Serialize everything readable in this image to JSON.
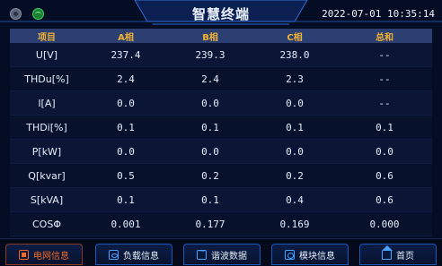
{
  "header": {
    "title": "智慧终端",
    "datetime": "2022-07-01 10:35:14"
  },
  "table": {
    "columns": [
      "项目",
      "A相",
      "B相",
      "C相",
      "总和"
    ],
    "rows": [
      [
        "U[V]",
        "237.4",
        "239.3",
        "238.0",
        "--"
      ],
      [
        "THDu[%]",
        "2.4",
        "2.4",
        "2.3",
        "--"
      ],
      [
        "I[A]",
        "0.0",
        "0.0",
        "0.0",
        "--"
      ],
      [
        "THDi[%]",
        "0.1",
        "0.1",
        "0.1",
        "0.1"
      ],
      [
        "P[kW]",
        "0.0",
        "0.0",
        "0.0",
        "0.0"
      ],
      [
        "Q[kvar]",
        "0.5",
        "0.2",
        "0.2",
        "0.6"
      ],
      [
        "S[kVA]",
        "0.1",
        "0.1",
        "0.4",
        "0.6"
      ],
      [
        "COSΦ",
        "0.001",
        "0.177",
        "0.169",
        "0.000"
      ]
    ]
  },
  "footer": {
    "tabs": [
      {
        "label": "电网信息",
        "icon": "grid-icon",
        "active": true
      },
      {
        "label": "负载信息",
        "icon": "load-icon",
        "active": false
      },
      {
        "label": "谐波数据",
        "icon": "wave-icon",
        "active": false
      },
      {
        "label": "模块信息",
        "icon": "module-icon",
        "active": false
      },
      {
        "label": "首页",
        "icon": "home-icon",
        "active": false
      }
    ]
  },
  "colors": {
    "background": "#050d24",
    "header_text": "#f2b233",
    "active_tab": "#f06a2a",
    "accent": "#1d5ab8"
  }
}
